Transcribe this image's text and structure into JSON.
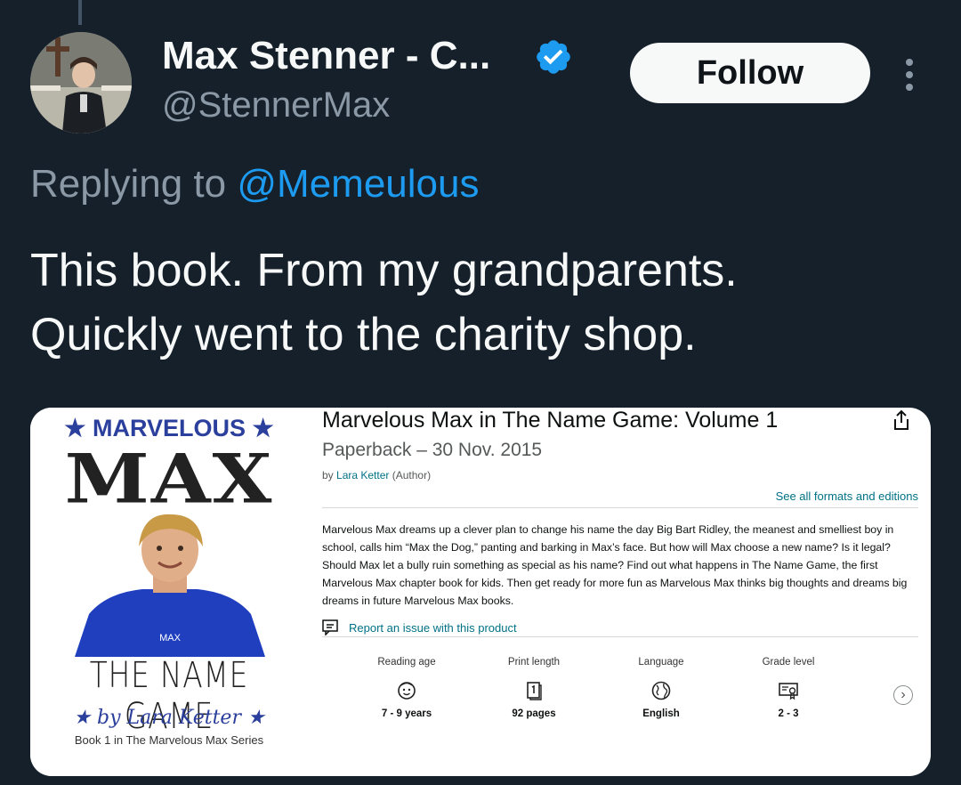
{
  "tweet": {
    "display_name": "Max Stenner - C...",
    "handle": "@StennerMax",
    "follow_label": "Follow",
    "replying_prefix": "Replying to",
    "replying_mention": "@Memeulous",
    "text_line1": "This book. From my grandparents.",
    "text_line2": "Quickly went to the charity shop.",
    "accent_color": "#1d9bf0"
  },
  "product": {
    "cover": {
      "series_title": "★ MARVELOUS ★",
      "main_title": "MAX",
      "subtitle": "THE NAME GAME",
      "byline": "★ by Lara Ketter ★",
      "book_line": "Book 1 in The Marvelous Max Series",
      "shirt_text": "MAX"
    },
    "title": "Marvelous Max in The Name Game: Volume 1",
    "format_date": "Paperback – 30 Nov. 2015",
    "by_prefix": "by",
    "author": "Lara Ketter",
    "author_role": "(Author)",
    "see_all_formats": "See all formats and editions",
    "description": "Marvelous Max dreams up a clever plan to change his name the day Big Bart Ridley, the meanest and smelliest boy in school, calls him “Max the Dog,” panting and barking in Max’s face. But how will Max choose a new name? Is it legal? Should Max let a bully ruin something as special as his name? Find out what happens in The Name Game, the first Marvelous Max chapter book for kids. Then get ready for more fun as Marvelous Max thinks big thoughts and dreams big dreams in future Marvelous Max books.",
    "report_link": "Report an issue with this product",
    "specs": [
      {
        "label": "Reading age",
        "value": "7 - 9 years",
        "icon": "child-face-icon"
      },
      {
        "label": "Print length",
        "value": "92 pages",
        "icon": "book-pages-icon"
      },
      {
        "label": "Language",
        "value": "English",
        "icon": "globe-icon"
      },
      {
        "label": "Grade level",
        "value": "2 - 3",
        "icon": "certificate-icon"
      }
    ],
    "next_label": "›"
  }
}
